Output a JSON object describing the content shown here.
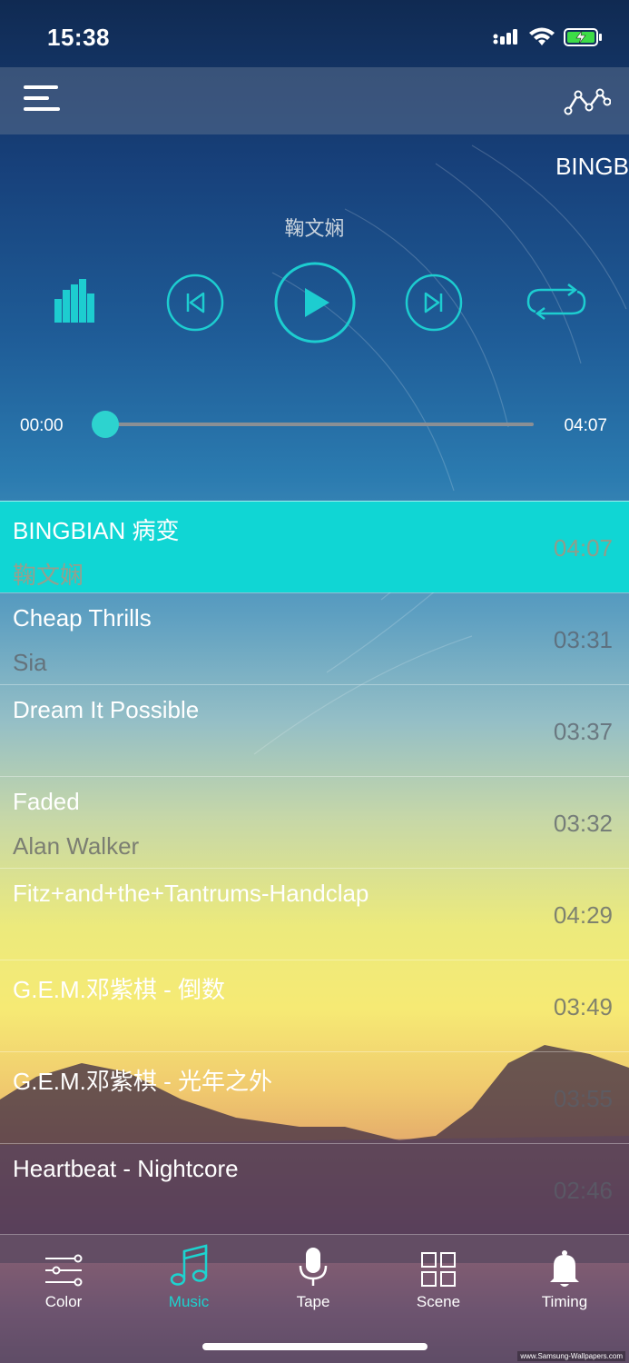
{
  "status_bar": {
    "time": "15:38",
    "battery": "charging"
  },
  "header": {
    "menu_icon": "hamburger-menu-icon",
    "right_icon": "line-graph-icon"
  },
  "now_playing": {
    "marquee_title": "BINGB",
    "artist": "鞠文娴",
    "current_time": "00:00",
    "total_time": "04:07",
    "progress": 0
  },
  "controls": {
    "equalizer": "equalizer-bars-icon",
    "previous": "previous-track-icon",
    "play": "play-icon",
    "next": "next-track-icon",
    "repeat": "repeat-icon"
  },
  "songs": [
    {
      "title": "BINGBIAN 病变",
      "artist": "鞠文娴",
      "duration": "04:07",
      "active": true
    },
    {
      "title": "Cheap Thrills",
      "artist": "Sia",
      "duration": "03:31"
    },
    {
      "title": "Dream It Possible",
      "artist": "",
      "duration": "03:37"
    },
    {
      "title": "Faded",
      "artist": "Alan Walker",
      "duration": "03:32"
    },
    {
      "title": "Fitz+and+the+Tantrums-Handclap",
      "artist": "",
      "duration": "04:29"
    },
    {
      "title": "G.E.M.邓紫棋 - 倒数",
      "artist": "",
      "duration": "03:49"
    },
    {
      "title": "G.E.M.邓紫棋 - 光年之外",
      "artist": "",
      "duration": "03:55"
    },
    {
      "title": "Heartbeat - Nightcore",
      "artist": "",
      "duration": "02:46"
    }
  ],
  "tabs": [
    {
      "label": "Color",
      "icon": "sliders-icon"
    },
    {
      "label": "Music",
      "icon": "music-note-icon",
      "active": true
    },
    {
      "label": "Tape",
      "icon": "microphone-icon"
    },
    {
      "label": "Scene",
      "icon": "grid-icon"
    },
    {
      "label": "Timing",
      "icon": "bell-icon"
    }
  ],
  "watermark": "www.Samsung-Wallpapers.com",
  "colors": {
    "accent": "#10d6d4",
    "active_row": "#10d6d4"
  }
}
